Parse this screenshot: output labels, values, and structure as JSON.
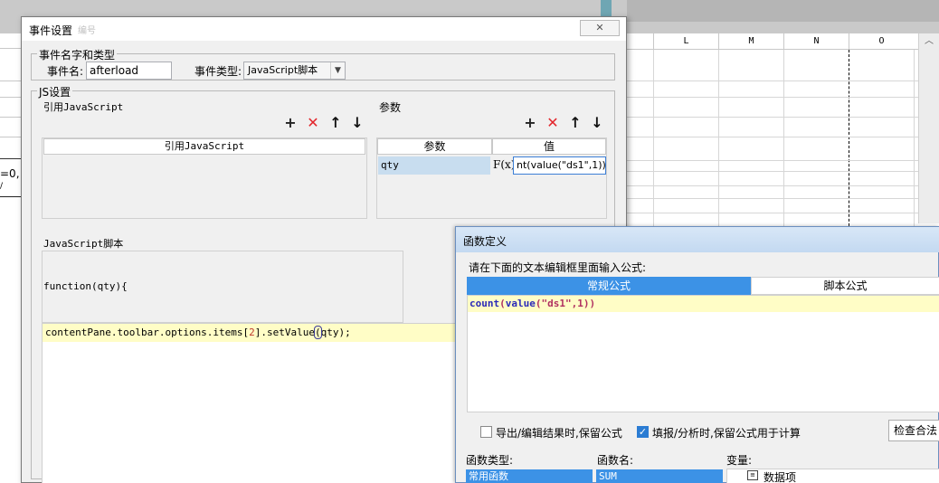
{
  "sheet": {
    "columns": [
      "L",
      "M",
      "N",
      "O"
    ],
    "left_fragments": [
      "=0,",
      "/"
    ]
  },
  "event_dialog": {
    "title": "事件设置",
    "title_suffix": "编号",
    "close_glyph": "✕",
    "name_type_group": "事件名字和类型",
    "event_name_label": "事件名:",
    "event_name_value": "afterload",
    "event_type_label": "事件类型:",
    "event_type_value": "JavaScript脚本",
    "js_group": "JS设置",
    "ref_js_label": "引用JavaScript",
    "ref_js_header": "引用JavaScript",
    "params_label": "参数",
    "params_header_name": "参数",
    "params_header_value": "值",
    "param_name": "qty",
    "param_fx": "F(x)",
    "param_value": "nt(value(\"ds1\",1))",
    "script_label": "JavaScript脚本",
    "script_head": "function(qty){",
    "script_line_a": "contentPane.toolbar.options.items[",
    "script_line_num": "2",
    "script_line_b": "].setValue",
    "script_line_paren": "(",
    "script_line_c": "qty);",
    "toolbar_icons": {
      "add": "+",
      "delete": "✕",
      "up": "↑",
      "down": "↓"
    },
    "delete_color": "#e3262c"
  },
  "formula_dialog": {
    "title": "函数定义",
    "prompt": "请在下面的文本编辑框里面输入公式:",
    "tab_normal": "常规公式",
    "tab_script": "脚本公式",
    "formula_fn": "count",
    "formula_open": "(",
    "formula_inner_fn": "value",
    "formula_args_open": "(",
    "formula_string": "\"ds1\"",
    "formula_rest": ",1))",
    "check_export": "导出/编辑结果时,保留公式",
    "check_export_on": false,
    "check_fill": "填报/分析时,保留公式用于计算",
    "check_fill_on": true,
    "check_button": "检查合法",
    "func_type_label": "函数类型:",
    "func_name_label": "函数名:",
    "variable_label": "变量:",
    "func_type_selected": "常用函数",
    "func_name_selected": "SUM",
    "variable_item": "数据项",
    "accent": "#3c92e6"
  }
}
